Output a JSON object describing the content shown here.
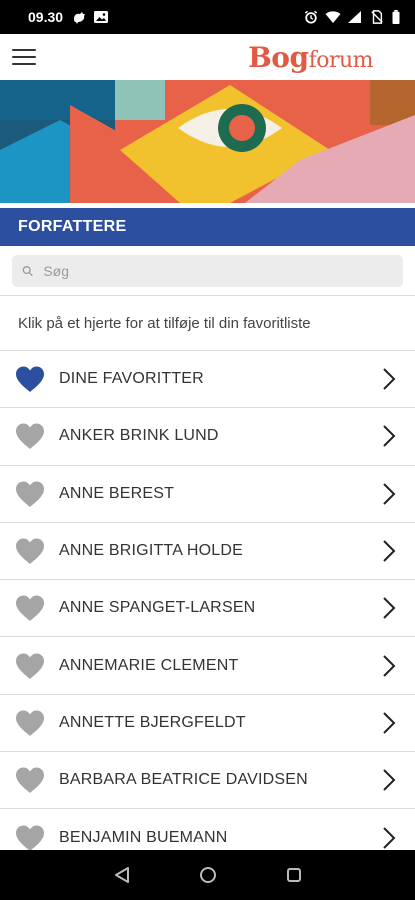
{
  "status_bar": {
    "time": "09.30",
    "left_icons": [
      "rooster-icon",
      "image-icon"
    ],
    "right_icons": [
      "alarm-icon",
      "wifi-icon",
      "signal-icon",
      "no-sim-icon",
      "battery-icon"
    ]
  },
  "header": {
    "logo_part1": "Bog",
    "logo_part2": "forum",
    "menu_icon": "hamburger-menu-icon",
    "brand_color": "#e05a44"
  },
  "section": {
    "title": "FORFATTERE",
    "color": "#2c4fa0"
  },
  "search": {
    "placeholder": "Søg",
    "value": ""
  },
  "hint": "Klik på et hjerte for at tilføje til din favoritliste",
  "authors": [
    {
      "name": "DINE FAVORITTER",
      "favorite": true
    },
    {
      "name": "ANKER BRINK LUND",
      "favorite": false
    },
    {
      "name": "ANNE BEREST",
      "favorite": false
    },
    {
      "name": "ANNE BRIGITTA HOLDE",
      "favorite": false
    },
    {
      "name": "ANNE SPANGET-LARSEN",
      "favorite": false
    },
    {
      "name": "ANNEMARIE CLEMENT",
      "favorite": false
    },
    {
      "name": "ANNETTE BJERGFELDT",
      "favorite": false
    },
    {
      "name": "BARBARA BEATRICE DAVIDSEN",
      "favorite": false
    },
    {
      "name": "BENJAMIN BUEMANN",
      "favorite": false
    }
  ],
  "colors": {
    "heart_active": "#2c4fa0",
    "heart_inactive": "#a5a5a5"
  },
  "nav": [
    "back-icon",
    "home-icon",
    "recents-icon"
  ]
}
